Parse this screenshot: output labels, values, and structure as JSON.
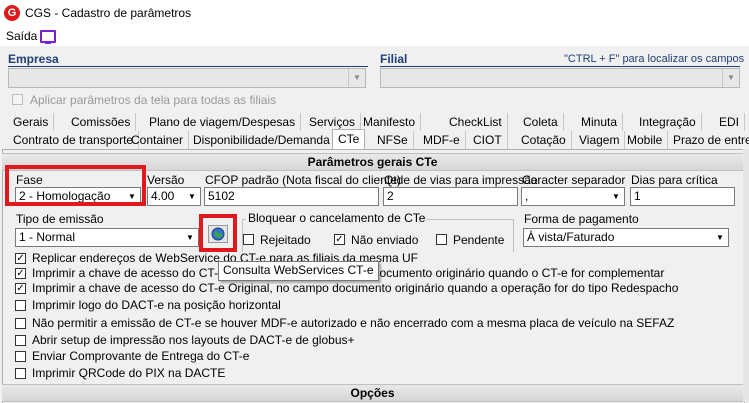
{
  "window": {
    "title": "CGS - Cadastro de parâmetros",
    "logo_letter": "G"
  },
  "menu": {
    "saida": "Saída"
  },
  "empresa": {
    "label": "Empresa"
  },
  "filial": {
    "label": "Filial",
    "hint": "\"CTRL + F\" para localizar os campos"
  },
  "apply_all": {
    "label": "Aplicar parâmetros da tela para todas as filiais",
    "checked": false
  },
  "tabs_row1": [
    "Gerais",
    "Comissões",
    "Plano de viagem/Despesas",
    "Serviços",
    "Manifesto",
    "CheckList",
    "Coleta",
    "Minuta",
    "Integração",
    "EDI"
  ],
  "tabs_row2": [
    "Contrato de transporte",
    "Container",
    "Disponibilidade/Demanda",
    "CTe",
    "NFSe",
    "MDF-e",
    "CIOT",
    "Cotação",
    "Viagem",
    "Mobile",
    "Prazo de entreg"
  ],
  "section_title": "Parâmetros gerais CTe",
  "fase": {
    "label": "Fase",
    "value": "2 - Homologação"
  },
  "versao": {
    "label": "Versão",
    "value": "4.00"
  },
  "cfop": {
    "label": "CFOP padrão (Nota fiscal do cliente)",
    "value": "5102"
  },
  "qtde_vias": {
    "label": "Qtde de vias para impressão",
    "value": "2"
  },
  "caracter": {
    "label": "Caracter separador",
    "value": ","
  },
  "dias": {
    "label": "Dias para crítica",
    "value": "1"
  },
  "tipo_emissao": {
    "label": "Tipo de emissão",
    "value": "1 - Normal"
  },
  "bloquear": {
    "label": "Bloquear o cancelamento de CTe",
    "options": [
      {
        "label": "Rejeitado",
        "checked": false
      },
      {
        "label": "Não enviado",
        "checked": true
      },
      {
        "label": "Pendente",
        "checked": false
      }
    ]
  },
  "forma_pagamento": {
    "label": "Forma de pagamento",
    "value": "À vista/Faturado"
  },
  "tooltip": "Consulta WebServices CT-e",
  "checks": [
    {
      "label": "Replicar endereços de WebService do CT-e para as filiais da mesma UF",
      "checked": true
    },
    {
      "label": "Imprimir a chave de acesso do CT-e complementado no campo documento originário quando o CT-e for complementar",
      "checked": true
    },
    {
      "label": "Imprimir a chave de acesso do CT-e Original, no campo documento originário quando a operação for do tipo Redespacho",
      "checked": true
    },
    {
      "label": "Imprimir logo do DACT-e na posição horizontal",
      "checked": false
    },
    {
      "label": "Não permitir a emissão de CT-e se houver MDF-e autorizado e não encerrado com a mesma placa de veículo na SEFAZ",
      "checked": false
    },
    {
      "label": "Abrir setup de impressão nos layouts de DACT-e de globus+",
      "checked": false
    },
    {
      "label": "Enviar Comprovante de Entrega do CT-e",
      "checked": false
    },
    {
      "label": "Imprimir QRCode do PIX na DACTE",
      "checked": false
    }
  ],
  "opcoes_title": "Opções",
  "colors": {
    "highlight_red": "#e0191e",
    "header_blue": "#1f3f7a",
    "accent_purple": "#7a1fd1"
  }
}
